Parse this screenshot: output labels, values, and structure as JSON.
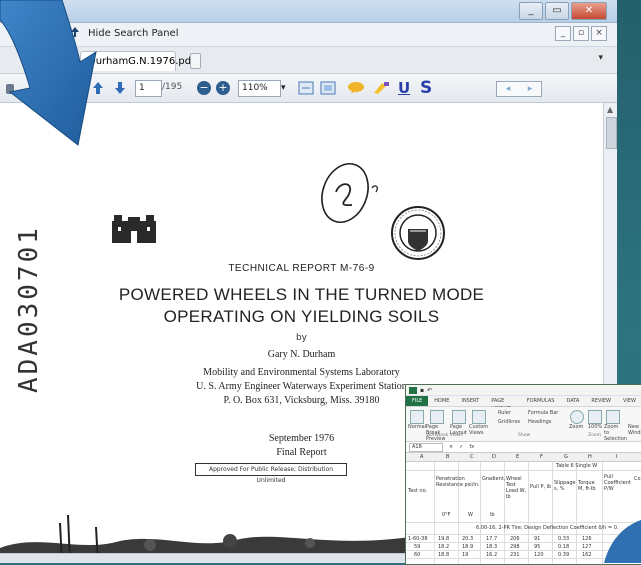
{
  "window": {
    "controls": {
      "minimize": "_",
      "maximize": "▭",
      "close": "✕"
    }
  },
  "menubar": {
    "hide_search_label": "Hide Search Panel",
    "dropdown_glyph": "▾",
    "mini_controls": [
      "_",
      "▫",
      "×"
    ]
  },
  "tabs": {
    "active_tab": "DurhamG.N.1976.pdf",
    "overflow_glyph": "▾"
  },
  "toolbar": {
    "page_current": "1",
    "page_total": "/195",
    "zoom": "110%",
    "zoom_dropdown": "▾",
    "underline_label": "U",
    "strike_label": "S",
    "prev_glyph": "◂",
    "next_glyph": "▸"
  },
  "document": {
    "report_number": "TECHNICAL REPORT M-76-9",
    "title_line1": "POWERED WHEELS IN THE TURNED MODE",
    "title_line2": "OPERATING ON YIELDING SOILS",
    "by": "by",
    "author": "Gary N. Durham",
    "affiliation_1": "Mobility and Environmental Systems Laboratory",
    "affiliation_2": "U. S. Army Engineer Waterways Experiment Station",
    "affiliation_3": "P. O. Box 631, Vicksburg, Miss. 39180",
    "date": "September 1976",
    "report_type": "Final Report",
    "release_note": "Approved For Public Release; Distribution Unlimited",
    "side_number": "ADA030701",
    "handwritten_mark": "2"
  },
  "excel": {
    "ribbon_tabs": [
      "FILE",
      "HOME",
      "INSERT",
      "PAGE LAYOUT",
      "FORMULAS",
      "DATA",
      "REVIEW",
      "VIEW"
    ],
    "active_ribbon_tab": "VIEW",
    "ribbon_items": {
      "normal": "Normal",
      "page_break": "Page Break Preview",
      "page_layout": "Page Layout",
      "custom_views": "Custom Views",
      "ruler": "Ruler",
      "formula_bar": "Formula Bar",
      "gridlines": "Gridlines",
      "headings": "Headings",
      "zoom": "Zoom",
      "zoom_100": "100%",
      "zoom_selection": "Zoom to Selection",
      "new_window": "New Window"
    },
    "group_labels": [
      "Workbook Views",
      "Show",
      "Zoom"
    ],
    "name_box": "A18",
    "fx": "fx",
    "columns": [
      "A",
      "B",
      "C",
      "D",
      "E",
      "F",
      "G",
      "H",
      "I"
    ],
    "table_caption": "Table 6 Single W",
    "headers": [
      "Test no.",
      "Penetration Resistance psi/in.",
      "Gradient,",
      "Wheel Test Load W, lb",
      "Pull P, lb",
      "Slippage s, %",
      "Torque M, ft-lb",
      "Pull Coefficient P/W",
      "Co"
    ],
    "units_row": [
      "",
      "0°F",
      "W",
      "lb",
      "",
      "",
      "",
      "",
      ""
    ],
    "subtitle": "6.00-16, 2-PR Tire; Design Deflection Coefficient δ/h = 0.",
    "rows": [
      [
        "1-60-38",
        "19.8",
        "20.3",
        "17.7",
        "206",
        "91",
        "0.33",
        "126"
      ],
      [
        "59",
        "18.2",
        "18.9",
        "18.3",
        "298",
        "95",
        "0.18",
        "127"
      ],
      [
        "60",
        "18.8",
        "19",
        "16.2",
        "231",
        "120",
        "0.39",
        "162"
      ]
    ]
  }
}
